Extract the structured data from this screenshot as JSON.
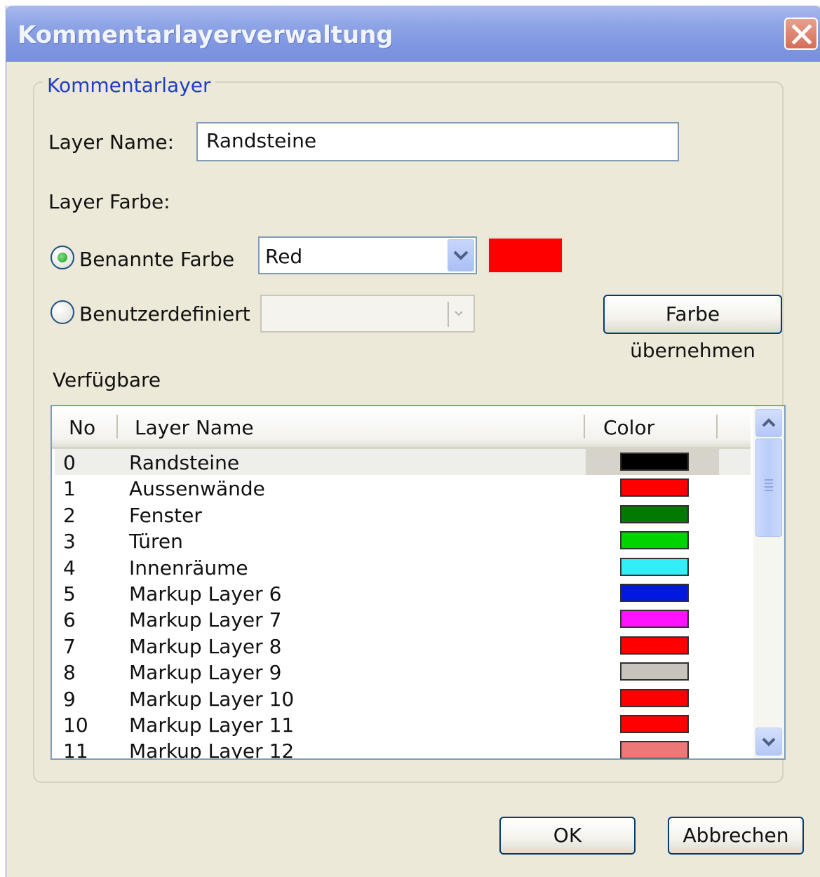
{
  "window": {
    "title": "Kommentarlayerverwaltung"
  },
  "group": {
    "title": "Kommentarlayer"
  },
  "form": {
    "layer_name_label": "Layer Name:",
    "layer_name_value": "Randsteine",
    "layer_color_label": "Layer Farbe:",
    "named_color_label": "Benannte Farbe",
    "named_color_value": "Red",
    "named_color_selected": true,
    "custom_color_label": "Benutzerdefiniert",
    "custom_color_value": "",
    "preview_color": "#ff0000",
    "apply_button": "Farbe übernehmen"
  },
  "available": {
    "label": "Verfügbare",
    "columns": [
      "No",
      "Layer Name",
      "Color"
    ],
    "rows": [
      {
        "no": "0",
        "name": "Randsteine",
        "color": "#000000",
        "selected": true
      },
      {
        "no": "1",
        "name": "Aussenwände",
        "color": "#ff0000"
      },
      {
        "no": "2",
        "name": "Fenster",
        "color": "#007a00"
      },
      {
        "no": "3",
        "name": "Türen",
        "color": "#00d400"
      },
      {
        "no": "4",
        "name": "Innenräume",
        "color": "#33eef7"
      },
      {
        "no": "5",
        "name": "Markup Layer 6",
        "color": "#0018e0"
      },
      {
        "no": "6",
        "name": "Markup Layer 7",
        "color": "#ff12ff"
      },
      {
        "no": "7",
        "name": "Markup Layer 8",
        "color": "#ff0000"
      },
      {
        "no": "8",
        "name": "Markup Layer 9",
        "color": "#c8c4bc"
      },
      {
        "no": "9",
        "name": "Markup Layer 10",
        "color": "#ff0000"
      },
      {
        "no": "10",
        "name": "Markup Layer 11",
        "color": "#ff0000"
      },
      {
        "no": "11",
        "name": "Markup Layer 12",
        "color": "#ee7878"
      }
    ]
  },
  "buttons": {
    "ok": "OK",
    "cancel": "Abbrechen"
  }
}
